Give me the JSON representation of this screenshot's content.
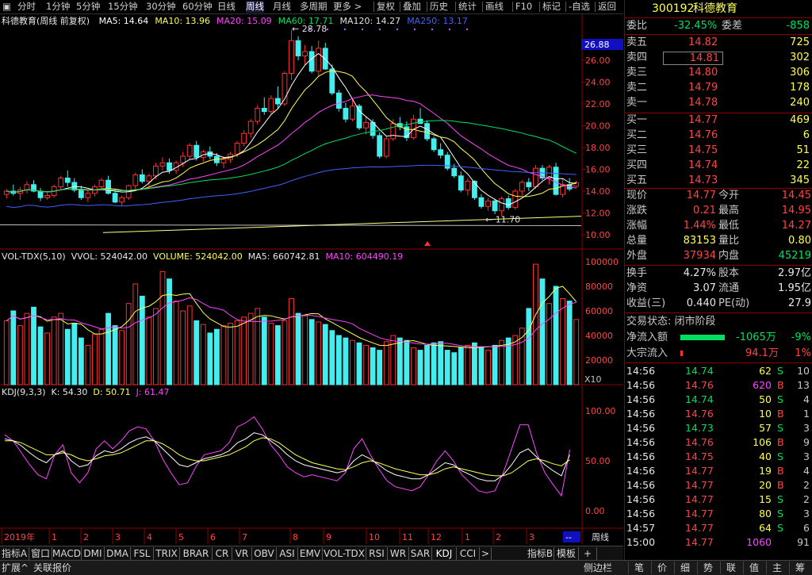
{
  "topbar": {
    "items": [
      "分时",
      "1分钟",
      "5分钟",
      "15分钟",
      "30分钟",
      "60分钟",
      "日线",
      "周线",
      "月线",
      "多周期",
      "更多 >"
    ],
    "active": "周线",
    "right_items": [
      "复权",
      "叠加",
      "历史",
      "统计",
      "画线",
      "F10",
      "标记",
      "-自选",
      "返回"
    ]
  },
  "main": {
    "title": "科德教育(周线 前复权)",
    "ma": [
      {
        "label": "MA5: 14.64",
        "color": "#ffffff"
      },
      {
        "label": "MA10: 13.96",
        "color": "#ffff55"
      },
      {
        "label": "MA20: 15.09",
        "color": "#ff44ff"
      },
      {
        "label": "MA60: 17.71",
        "color": "#00e060"
      },
      {
        "label": "MA120: 14.27",
        "color": "#e0e0e0"
      },
      {
        "label": "MA250: 13.17",
        "color": "#4060ff"
      }
    ],
    "high_marker": "28.78",
    "low_marker": "11.70",
    "price_axis": [
      "26.00",
      "24.00",
      "22.00",
      "20.00",
      "18.00",
      "16.00",
      "14.00",
      "12.00",
      "10.00"
    ],
    "current_price_tag": "26.88"
  },
  "volume": {
    "title": "VOL-TDX(5,10)",
    "vvol": "VVOL: 524042.00",
    "volume": "VOLUME: 524042.00",
    "ma5": "MA5: 660742.81",
    "ma10": "MA10: 604490.19",
    "axis": [
      "100000",
      "80000",
      "60000",
      "40000",
      "20000"
    ],
    "unit": "X10"
  },
  "kdj": {
    "title": "KDJ(9,3,3)",
    "k": "K: 54.30",
    "d": "D: 50.71",
    "j": "J: 61.47",
    "axis": [
      "100.00",
      "50.00",
      "0.00"
    ]
  },
  "timeline": {
    "labels": [
      "2019年",
      "1",
      "2",
      "3",
      "4",
      "5",
      "6",
      "7",
      "8",
      "9",
      "10",
      "11",
      "12",
      "1",
      "2",
      "3"
    ],
    "period": "周线",
    "dash": "--"
  },
  "bottombar": {
    "items": [
      "指标A",
      "窗口",
      "MACD",
      "DMI",
      "DMA",
      "FSL",
      "TRIX",
      "BRAR",
      "CR",
      "VR",
      "OBV",
      "ASI",
      "EMV",
      "VOL-TDX",
      "RSI",
      "WR",
      "SAR",
      "KDJ",
      "CCI",
      ">"
    ],
    "right": [
      "指标B",
      "模板",
      "+"
    ]
  },
  "statusbar": {
    "left": [
      "扩展^",
      "关联报价"
    ],
    "right_label": "侧边栏",
    "tabs": [
      "笔",
      "价",
      "细",
      "势",
      "联",
      "值",
      "主",
      "筹"
    ]
  },
  "quote": {
    "code": "300192",
    "name": "科德教育",
    "weibi_label": "委比",
    "weibi": "-32.45%",
    "weicha_label": "委差",
    "weicha": "-858",
    "asks": [
      {
        "label": "卖五",
        "price": "14.82",
        "vol": "725"
      },
      {
        "label": "卖四",
        "price": "14.81",
        "vol": "302"
      },
      {
        "label": "卖三",
        "price": "14.80",
        "vol": "306"
      },
      {
        "label": "卖二",
        "price": "14.79",
        "vol": "178"
      },
      {
        "label": "卖一",
        "price": "14.78",
        "vol": "240"
      }
    ],
    "bids": [
      {
        "label": "买一",
        "price": "14.77",
        "vol": "469"
      },
      {
        "label": "买二",
        "price": "14.76",
        "vol": "6"
      },
      {
        "label": "买三",
        "price": "14.75",
        "vol": "51"
      },
      {
        "label": "买四",
        "price": "14.74",
        "vol": "22"
      },
      {
        "label": "买五",
        "price": "14.73",
        "vol": "345"
      }
    ],
    "stats": [
      {
        "l1": "现价",
        "v1": "14.77",
        "c1": "red",
        "l2": "今开",
        "v2": "14.45",
        "c2": "red"
      },
      {
        "l1": "涨跌",
        "v1": "0.21",
        "c1": "red",
        "l2": "最高",
        "v2": "14.95",
        "c2": "red"
      },
      {
        "l1": "涨幅",
        "v1": "1.44%",
        "c1": "red",
        "l2": "最低",
        "v2": "14.27",
        "c2": "red"
      },
      {
        "l1": "总量",
        "v1": "83153",
        "c1": "yellow",
        "l2": "量比",
        "v2": "0.80",
        "c2": "yellow"
      },
      {
        "l1": "外盘",
        "v1": "37934",
        "c1": "red",
        "l2": "内盘",
        "v2": "45219",
        "c2": "green"
      }
    ],
    "stats2": [
      {
        "l1": "换手",
        "v1": "4.27%",
        "l2": "股本",
        "v2": "2.97亿"
      },
      {
        "l1": "净资",
        "v1": "3.07",
        "l2": "流通",
        "v2": "1.95亿"
      },
      {
        "l1": "收益(三)",
        "v1": "0.440",
        "l2": "PE(动)",
        "v2": "27.9"
      }
    ],
    "status_label": "交易状态: 闭市阶段",
    "netflow_label": "净流入额",
    "netflow": "-1065万",
    "netflow_pct": "-9%",
    "bigflow_label": "大宗流入",
    "bigflow": "94.1万",
    "bigflow_pct": "1%",
    "ticks": [
      {
        "t": "14:56",
        "p": "14.74",
        "pc": "green",
        "v": "62",
        "vc": "yellow",
        "bs": "S",
        "n": "10"
      },
      {
        "t": "14:56",
        "p": "14.76",
        "pc": "red",
        "v": "620",
        "vc": "magenta",
        "bs": "B",
        "n": "13"
      },
      {
        "t": "14:56",
        "p": "14.74",
        "pc": "green",
        "v": "50",
        "vc": "yellow",
        "bs": "S",
        "n": "4"
      },
      {
        "t": "14:56",
        "p": "14.76",
        "pc": "red",
        "v": "10",
        "vc": "yellow",
        "bs": "B",
        "n": "1"
      },
      {
        "t": "14:56",
        "p": "14.73",
        "pc": "green",
        "v": "57",
        "vc": "yellow",
        "bs": "S",
        "n": "3"
      },
      {
        "t": "14:56",
        "p": "14.76",
        "pc": "red",
        "v": "106",
        "vc": "yellow",
        "bs": "B",
        "n": "9"
      },
      {
        "t": "14:56",
        "p": "14.75",
        "pc": "red",
        "v": "40",
        "vc": "yellow",
        "bs": "S",
        "n": "3"
      },
      {
        "t": "14:56",
        "p": "14.77",
        "pc": "red",
        "v": "19",
        "vc": "yellow",
        "bs": "B",
        "n": "4"
      },
      {
        "t": "14:56",
        "p": "14.77",
        "pc": "red",
        "v": "20",
        "vc": "yellow",
        "bs": "B",
        "n": "2"
      },
      {
        "t": "14:56",
        "p": "14.77",
        "pc": "red",
        "v": "15",
        "vc": "yellow",
        "bs": "S",
        "n": "2"
      },
      {
        "t": "14:56",
        "p": "14.77",
        "pc": "red",
        "v": "80",
        "vc": "yellow",
        "bs": "S",
        "n": "3"
      },
      {
        "t": "14:57",
        "p": "14.77",
        "pc": "red",
        "v": "64",
        "vc": "yellow",
        "bs": "S",
        "n": "6"
      },
      {
        "t": "15:00",
        "p": "14.77",
        "pc": "red",
        "v": "1060",
        "vc": "magenta",
        "bs": "",
        "n": "91"
      }
    ]
  },
  "chart_data": {
    "type": "candlestick",
    "colors": {
      "up": "#ff3030",
      "down": "#44eeee",
      "ma5": "#ffffff",
      "ma10": "#ffff55",
      "ma20": "#ff44ff",
      "ma60": "#00e060",
      "ma250": "#4060ff"
    },
    "ohlc": [
      [
        13.7,
        14.2,
        13.3,
        14.0
      ],
      [
        14.0,
        14.6,
        13.6,
        13.8
      ],
      [
        13.8,
        14.4,
        13.2,
        14.1
      ],
      [
        14.1,
        14.9,
        13.8,
        14.6
      ],
      [
        14.6,
        15.0,
        13.9,
        14.0
      ],
      [
        14.0,
        14.3,
        13.1,
        13.4
      ],
      [
        13.4,
        13.9,
        13.2,
        13.6
      ],
      [
        13.6,
        14.6,
        13.4,
        14.4
      ],
      [
        14.4,
        15.4,
        14.2,
        15.2
      ],
      [
        15.2,
        15.9,
        14.4,
        14.8
      ],
      [
        14.8,
        15.2,
        13.9,
        14.1
      ],
      [
        14.1,
        14.5,
        13.2,
        13.4
      ],
      [
        13.4,
        14.1,
        13.0,
        13.8
      ],
      [
        13.8,
        14.6,
        13.5,
        14.4
      ],
      [
        14.4,
        15.2,
        14.2,
        15.0
      ],
      [
        15.0,
        15.4,
        13.7,
        13.8
      ],
      [
        13.8,
        14.2,
        12.9,
        13.0
      ],
      [
        13.0,
        13.6,
        12.6,
        13.4
      ],
      [
        13.4,
        14.6,
        13.2,
        14.5
      ],
      [
        14.5,
        15.7,
        14.2,
        15.5
      ],
      [
        15.5,
        16.0,
        14.7,
        14.9
      ],
      [
        14.9,
        15.6,
        14.4,
        15.4
      ],
      [
        15.4,
        16.6,
        15.1,
        16.3
      ],
      [
        16.3,
        17.1,
        15.9,
        16.6
      ],
      [
        16.6,
        17.0,
        15.6,
        15.9
      ],
      [
        15.9,
        16.8,
        15.6,
        16.6
      ],
      [
        16.6,
        17.6,
        16.2,
        17.2
      ],
      [
        17.2,
        18.4,
        16.9,
        18.2
      ],
      [
        18.2,
        18.6,
        16.8,
        17.1
      ],
      [
        17.1,
        17.8,
        16.7,
        17.6
      ],
      [
        17.6,
        18.1,
        16.9,
        17.2
      ],
      [
        17.2,
        17.5,
        16.3,
        16.6
      ],
      [
        16.6,
        17.2,
        16.1,
        16.9
      ],
      [
        16.9,
        17.6,
        16.6,
        17.4
      ],
      [
        17.4,
        18.6,
        17.1,
        18.4
      ],
      [
        18.4,
        19.6,
        18.1,
        19.3
      ],
      [
        19.3,
        20.6,
        18.9,
        20.4
      ],
      [
        20.4,
        21.9,
        20.1,
        21.6
      ],
      [
        21.6,
        22.6,
        21.0,
        21.3
      ],
      [
        21.3,
        22.8,
        21.1,
        22.5
      ],
      [
        22.5,
        23.6,
        21.6,
        22.0
      ],
      [
        22.0,
        25.0,
        21.8,
        24.8
      ],
      [
        24.8,
        28.78,
        24.2,
        27.8
      ],
      [
        27.8,
        28.2,
        26.0,
        26.4
      ],
      [
        26.4,
        27.4,
        25.6,
        26.8
      ],
      [
        26.8,
        27.3,
        24.8,
        25.0
      ],
      [
        25.0,
        27.8,
        24.6,
        27.1
      ],
      [
        27.1,
        27.6,
        25.1,
        25.2
      ],
      [
        25.2,
        25.6,
        22.8,
        23.0
      ],
      [
        23.0,
        23.3,
        21.3,
        21.6
      ],
      [
        21.6,
        22.1,
        20.3,
        20.6
      ],
      [
        20.6,
        22.5,
        20.4,
        21.8
      ],
      [
        21.8,
        22.0,
        19.6,
        19.8
      ],
      [
        19.8,
        20.8,
        19.2,
        20.3
      ],
      [
        20.3,
        20.6,
        18.8,
        19.1
      ],
      [
        19.1,
        19.4,
        17.0,
        17.2
      ],
      [
        17.2,
        19.0,
        17.0,
        18.8
      ],
      [
        18.8,
        20.6,
        18.6,
        20.2
      ],
      [
        20.2,
        20.8,
        19.6,
        19.9
      ],
      [
        19.9,
        20.4,
        18.6,
        18.9
      ],
      [
        18.9,
        21.0,
        18.7,
        20.6
      ],
      [
        20.6,
        21.6,
        20.2,
        20.2
      ],
      [
        20.2,
        20.5,
        18.6,
        18.8
      ],
      [
        18.8,
        19.0,
        17.6,
        17.8
      ],
      [
        17.8,
        18.4,
        17.0,
        17.3
      ],
      [
        17.3,
        17.6,
        15.9,
        16.1
      ],
      [
        16.1,
        16.5,
        15.2,
        15.4
      ],
      [
        15.4,
        15.8,
        13.9,
        14.1
      ],
      [
        14.1,
        15.2,
        13.6,
        14.9
      ],
      [
        14.9,
        15.0,
        13.2,
        13.4
      ],
      [
        13.4,
        13.7,
        12.4,
        12.6
      ],
      [
        12.6,
        13.4,
        12.2,
        13.1
      ],
      [
        13.1,
        13.3,
        11.9,
        12.2
      ],
      [
        12.2,
        13.5,
        11.7,
        13.3
      ],
      [
        13.3,
        13.6,
        12.3,
        12.5
      ],
      [
        12.5,
        14.2,
        12.3,
        14.0
      ],
      [
        14.0,
        15.0,
        13.6,
        14.8
      ],
      [
        14.8,
        15.2,
        14.0,
        14.4
      ],
      [
        14.4,
        16.4,
        14.2,
        16.1
      ],
      [
        16.1,
        16.4,
        15.0,
        15.2
      ],
      [
        15.2,
        16.4,
        14.6,
        16.2
      ],
      [
        16.2,
        16.6,
        13.6,
        13.7
      ],
      [
        13.7,
        15.2,
        13.4,
        14.6
      ],
      [
        14.6,
        15.2,
        14.0,
        14.2
      ],
      [
        14.45,
        14.95,
        14.27,
        14.77
      ]
    ],
    "volume": [
      52,
      60,
      48,
      58,
      63,
      47,
      42,
      55,
      58,
      45,
      50,
      38,
      32,
      41,
      45,
      58,
      48,
      44,
      66,
      82,
      72,
      55,
      62,
      92,
      86,
      68,
      60,
      64,
      52,
      49,
      42,
      45,
      48,
      50,
      52,
      55,
      58,
      62,
      55,
      50,
      48,
      52,
      70,
      58,
      56,
      53,
      51,
      49,
      44,
      40,
      38,
      36,
      34,
      32,
      30,
      28,
      35,
      40,
      38,
      36,
      30,
      28,
      32,
      34,
      35,
      28,
      26,
      30,
      32,
      34,
      30,
      28,
      32,
      36,
      38,
      40,
      46,
      62,
      98,
      86,
      66,
      80,
      70,
      68,
      53
    ],
    "kdj_k": [
      72,
      70,
      65,
      58,
      52,
      48,
      56,
      60,
      50,
      44,
      46,
      55,
      60,
      58,
      62,
      68,
      72,
      74,
      70,
      62,
      54,
      46,
      44,
      48,
      52,
      54,
      56,
      60,
      68,
      72,
      78,
      76,
      70,
      64,
      56,
      50,
      46,
      44,
      42,
      40,
      38,
      40,
      50,
      56,
      52,
      46,
      40,
      36,
      34,
      32,
      32,
      36,
      42,
      48,
      46,
      40,
      36,
      32,
      30,
      30,
      36,
      46,
      58,
      62,
      54,
      46,
      40,
      35,
      56
    ],
    "kdj_d": [
      70,
      70,
      68,
      64,
      60,
      56,
      56,
      58,
      56,
      52,
      50,
      52,
      55,
      56,
      58,
      62,
      66,
      70,
      70,
      67,
      62,
      56,
      52,
      50,
      50,
      52,
      54,
      56,
      60,
      64,
      70,
      73,
      72,
      68,
      62,
      56,
      52,
      48,
      46,
      44,
      42,
      41,
      44,
      48,
      50,
      48,
      45,
      42,
      40,
      38,
      36,
      36,
      38,
      42,
      44,
      42,
      40,
      38,
      36,
      35,
      35,
      38,
      44,
      50,
      52,
      50,
      47,
      45,
      51
    ],
    "kdj_j": [
      76,
      70,
      58,
      46,
      36,
      32,
      56,
      66,
      38,
      28,
      38,
      62,
      70,
      62,
      70,
      80,
      84,
      82,
      70,
      52,
      38,
      26,
      28,
      44,
      56,
      58,
      60,
      68,
      84,
      88,
      94,
      82,
      66,
      56,
      44,
      38,
      34,
      36,
      34,
      32,
      30,
      38,
      62,
      72,
      56,
      42,
      30,
      24,
      22,
      20,
      24,
      36,
      50,
      60,
      50,
      36,
      28,
      20,
      18,
      20,
      38,
      62,
      86,
      86,
      58,
      38,
      26,
      15,
      61
    ]
  }
}
